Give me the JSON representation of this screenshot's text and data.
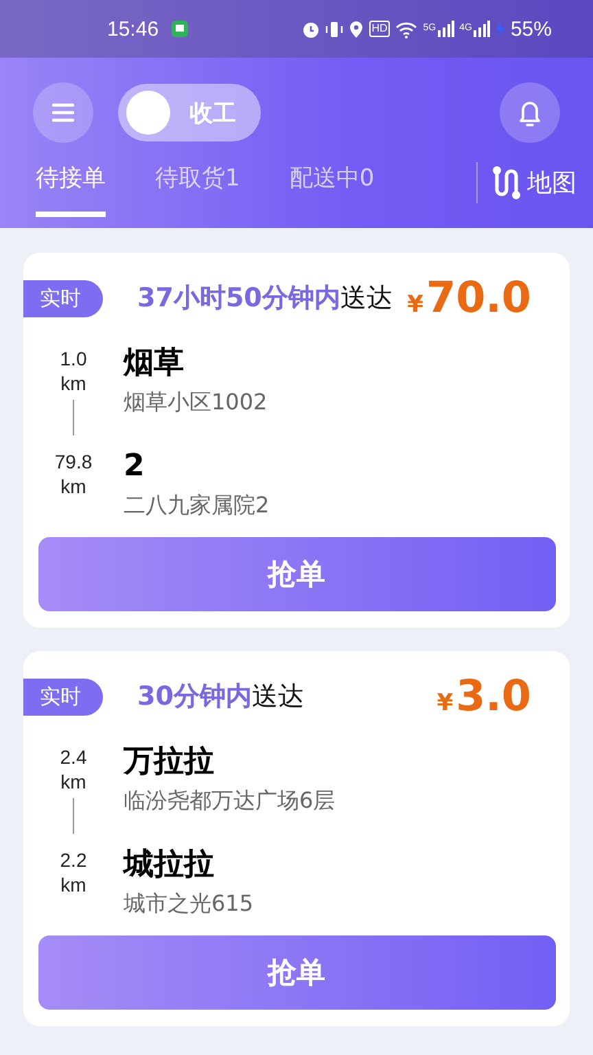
{
  "status_bar": {
    "time": "15:46",
    "network_5g": "5G",
    "network_4g": "4G",
    "hd": "HD",
    "battery": "55%"
  },
  "header": {
    "toggle": {
      "label": "收工",
      "on": false
    }
  },
  "tabs": [
    {
      "label": "待接单",
      "selected": true
    },
    {
      "label": "待取货1",
      "selected": false
    },
    {
      "label": "配送中0",
      "selected": false
    }
  ],
  "map_button": {
    "label": "地图"
  },
  "orders": [
    {
      "tag": "实时",
      "eta_highlight": "37小时50分钟内",
      "eta_suffix": "送达",
      "currency": "¥",
      "price": "70.0",
      "pickup": {
        "distance": "1.0",
        "unit": "km",
        "name": "烟草",
        "address": "烟草小区1002"
      },
      "dropoff": {
        "distance": "79.8",
        "unit": "km",
        "name": "2",
        "address": "二八九家属院2"
      },
      "button": "抢单"
    },
    {
      "tag": "实时",
      "eta_highlight": "30分钟内",
      "eta_suffix": "送达",
      "currency": "¥",
      "price": "3.0",
      "pickup": {
        "distance": "2.4",
        "unit": "km",
        "name": "万拉拉",
        "address": "临汾尧都万达广场6层"
      },
      "dropoff": {
        "distance": "2.2",
        "unit": "km",
        "name": "城拉拉",
        "address": "城市之光615"
      },
      "button": "抢单"
    }
  ]
}
